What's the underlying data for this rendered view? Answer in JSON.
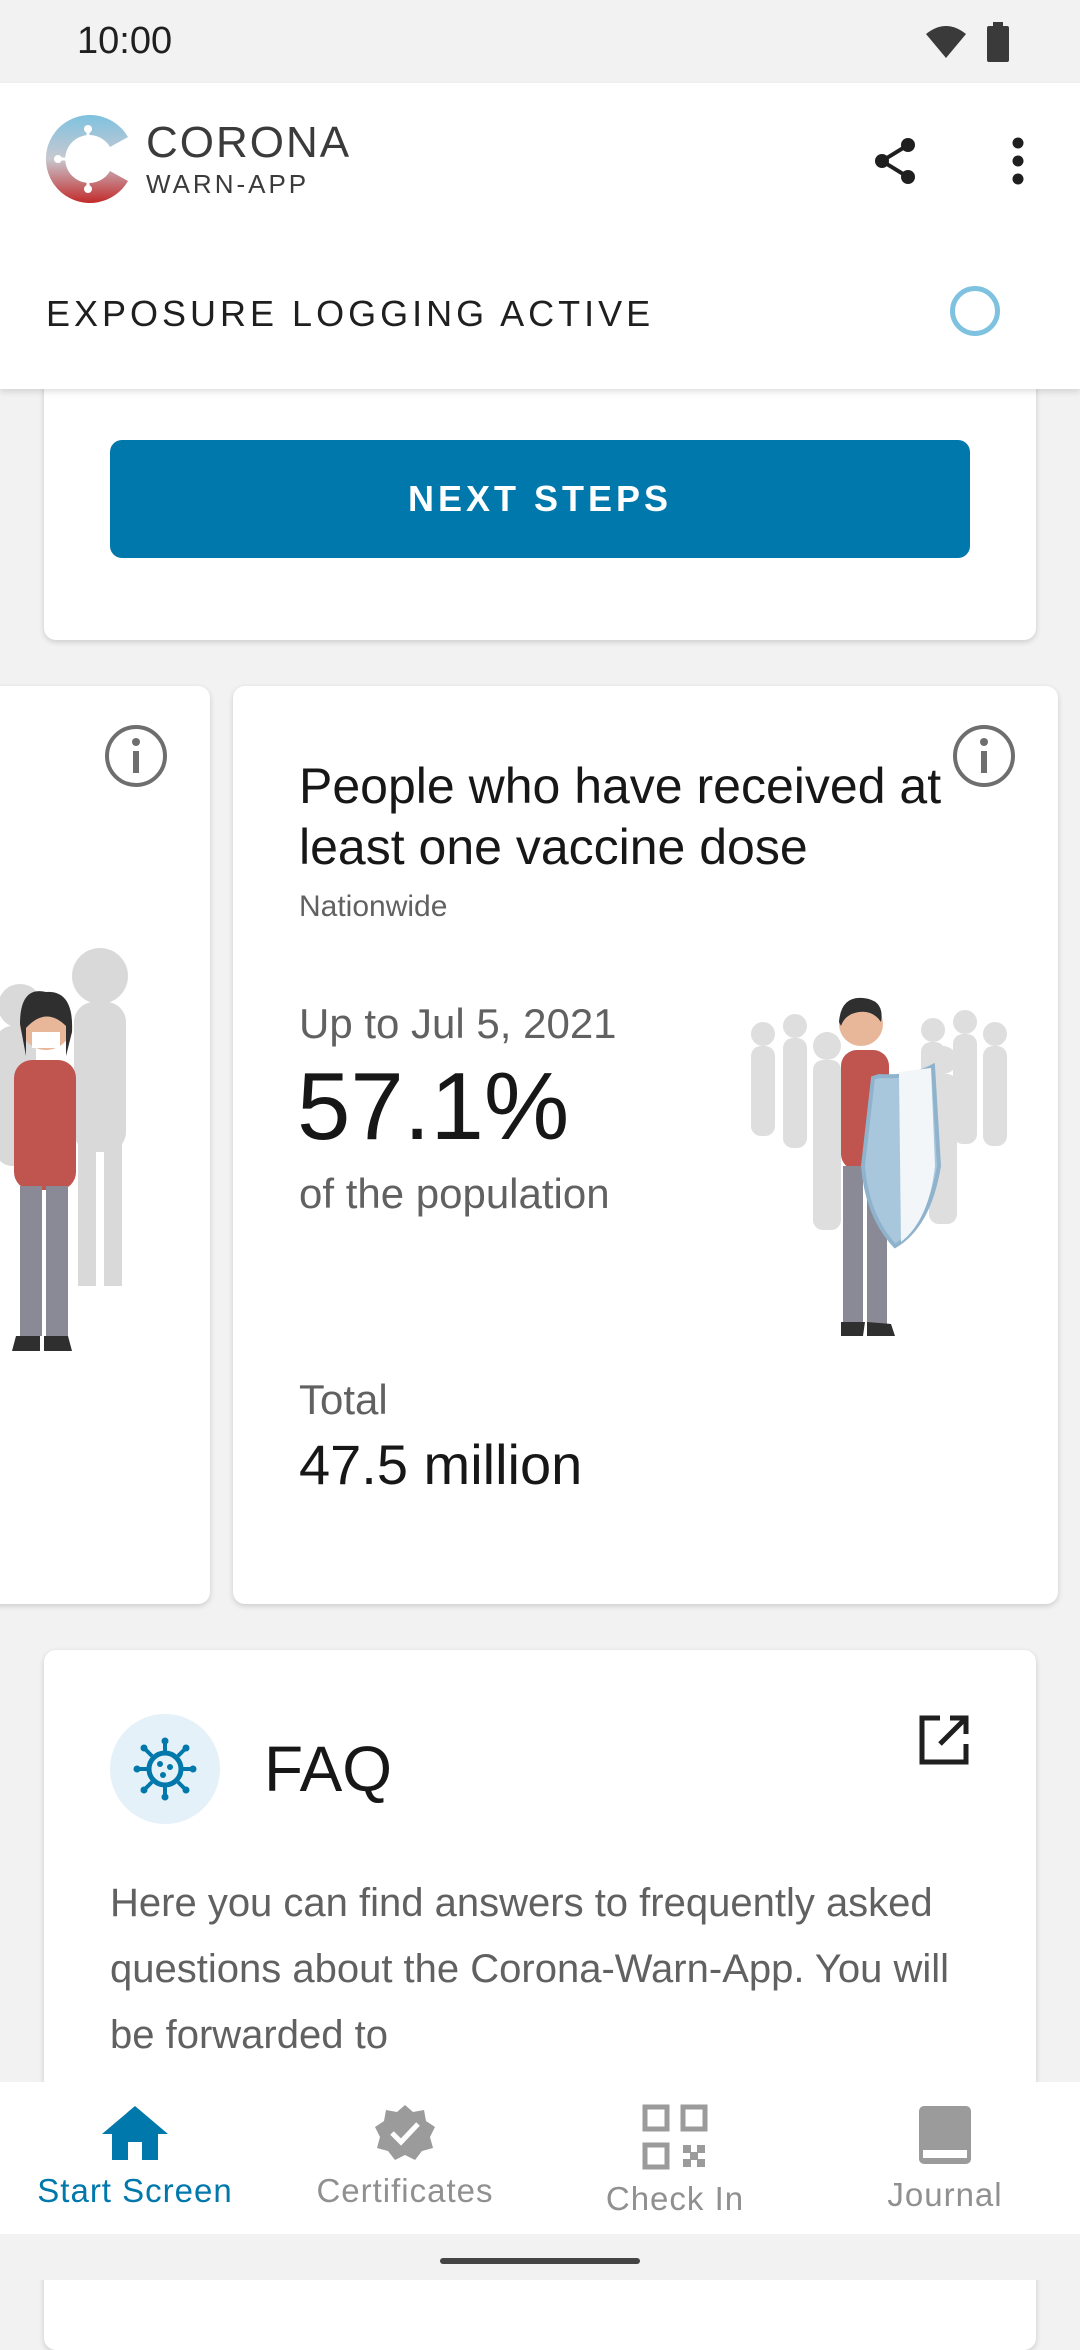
{
  "status_bar": {
    "time": "10:00"
  },
  "app_bar": {
    "logo_title": "CORONA",
    "logo_subtitle": "WARN-APP",
    "tracing_status": "EXPOSURE LOGGING ACTIVE",
    "accent_color": "#0078ab"
  },
  "next_steps_card": {
    "button_label": "NEXT STEPS"
  },
  "stats_card": {
    "title": "People who have received at least one vaccine dose",
    "region": "Nationwide",
    "date_label": "Up to Jul 5, 2021",
    "value": "57.1%",
    "value_desc": "of the population",
    "total_label": "Total",
    "total_value": "47.5 million"
  },
  "faq_card": {
    "title": "FAQ",
    "body": "Here you can find answers to frequently asked questions about the Corona-Warn-App. You will be forwarded to"
  },
  "bottom_nav": {
    "items": [
      {
        "label": "Start Screen",
        "icon": "home-icon",
        "active": true
      },
      {
        "label": "Certificates",
        "icon": "certificate-icon",
        "active": false
      },
      {
        "label": "Check In",
        "icon": "qr-code-icon",
        "active": false
      },
      {
        "label": "Journal",
        "icon": "journal-icon",
        "active": false
      }
    ]
  }
}
